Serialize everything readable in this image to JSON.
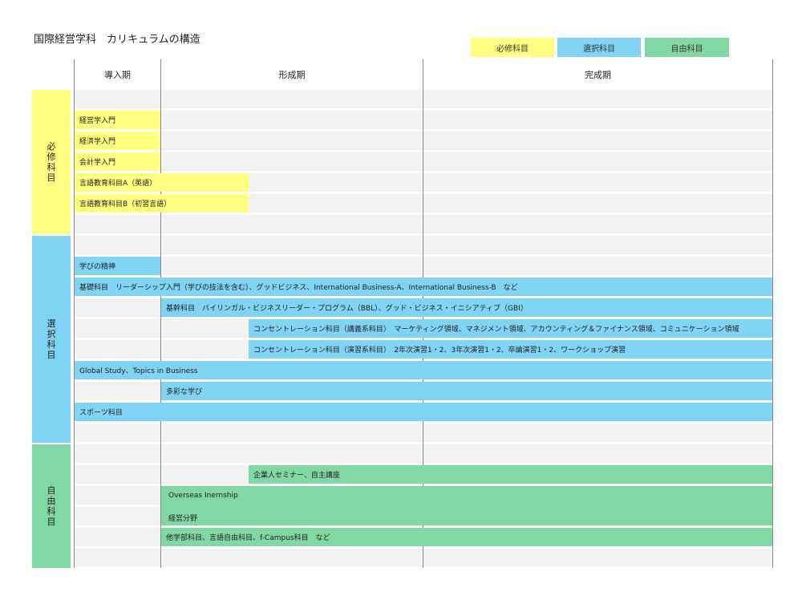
{
  "title": "国際経営学科　カリキュラムの構造",
  "legend": [
    {
      "label": "必修科目",
      "color": "#ffff80"
    },
    {
      "label": "選択科目",
      "color": "#7fd4f6"
    },
    {
      "label": "自由科目",
      "color": "#80d8a4"
    }
  ],
  "periods": [
    "導入期",
    "形成期",
    "完成期"
  ],
  "categories": {
    "required": "必修科目",
    "elective": "選択科目",
    "free": "自由科目"
  },
  "courses": {
    "keiei_nyumon": "経営学入門",
    "keizai_nyumon": "経済学入門",
    "kaikei_nyumon": "会計学入門",
    "gengo_a": "言語教育科目A（英語）",
    "gengo_b": "言語教育科目B（初習言語）",
    "manabi_seishin": "学びの精神",
    "kiso": "基礎科目　リーダーシップ入門（学びの技法を含む）、グッドビジネス、International Business-A、International Business-B　など",
    "kikan": "基幹科目　バイリンガル・ビジネスリーダー・プログラム（BBL）、グッド・ビジネス・イニシアティブ（GBI）",
    "conc_kogi": "コンセントレーション科目（講義系科目）　マーケティング領域、マネジメント領域、アカウンティング＆ファイナンス領域、コミュニケーション領域",
    "conc_enshu": "コンセントレーション科目（演習系科目）　2年次演習1・2、3年次演習1・2、卒論演習1・2、ワークショップ演習",
    "global": "Global Study、Topics in Business",
    "tasai": "多彩な学び",
    "sports": "スポーツ科目",
    "kigyo_seminar": "企業人セミナー、自主講座",
    "overseas": "Overseas Inernship",
    "keiei_bunya": "経営分野",
    "tagakubu": "他学部科目、言語自由科目、f-Campus科目　など"
  }
}
